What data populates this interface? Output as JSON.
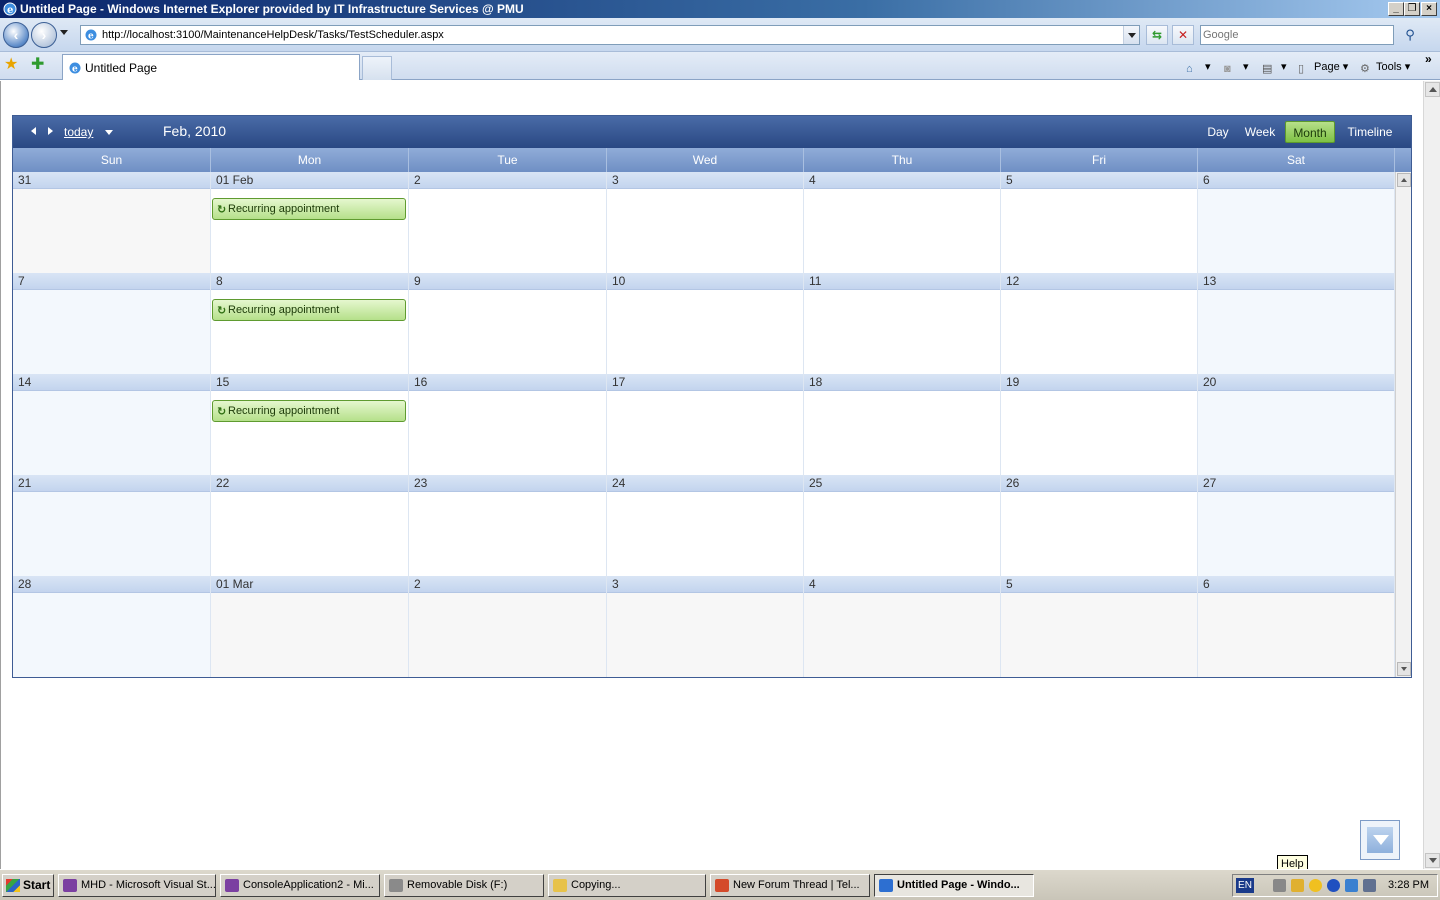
{
  "window": {
    "title": "Untitled Page - Windows Internet Explorer provided by IT Infrastructure Services @ PMU"
  },
  "browser": {
    "url": "http://localhost:3100/MaintenanceHelpDesk/Tasks/TestScheduler.aspx",
    "search_placeholder": "Google",
    "tab_label": "Untitled Page",
    "commands": {
      "page": "Page",
      "tools": "Tools"
    }
  },
  "scheduler": {
    "today_label": "today",
    "current_period": "Feb, 2010",
    "views": [
      "Day",
      "Week",
      "Month",
      "Timeline"
    ],
    "active_view": "Month",
    "day_names": [
      "Sun",
      "Mon",
      "Tue",
      "Wed",
      "Thu",
      "Fri",
      "Sat"
    ],
    "weeks": [
      {
        "days": [
          {
            "label": "31",
            "other": true
          },
          {
            "label": "01 Feb",
            "appt": "Recurring appointment"
          },
          {
            "label": "2"
          },
          {
            "label": "3"
          },
          {
            "label": "4"
          },
          {
            "label": "5"
          },
          {
            "label": "6"
          }
        ]
      },
      {
        "days": [
          {
            "label": "7"
          },
          {
            "label": "8",
            "appt": "Recurring appointment"
          },
          {
            "label": "9"
          },
          {
            "label": "10"
          },
          {
            "label": "11"
          },
          {
            "label": "12"
          },
          {
            "label": "13"
          }
        ]
      },
      {
        "days": [
          {
            "label": "14"
          },
          {
            "label": "15",
            "appt": "Recurring appointment"
          },
          {
            "label": "16"
          },
          {
            "label": "17"
          },
          {
            "label": "18"
          },
          {
            "label": "19"
          },
          {
            "label": "20"
          }
        ]
      },
      {
        "days": [
          {
            "label": "21"
          },
          {
            "label": "22"
          },
          {
            "label": "23"
          },
          {
            "label": "24"
          },
          {
            "label": "25"
          },
          {
            "label": "26"
          },
          {
            "label": "27"
          }
        ]
      },
      {
        "days": [
          {
            "label": "28"
          },
          {
            "label": "01 Mar",
            "other": true
          },
          {
            "label": "2",
            "other": true
          },
          {
            "label": "3",
            "other": true
          },
          {
            "label": "4",
            "other": true
          },
          {
            "label": "5",
            "other": true
          },
          {
            "label": "6",
            "other": true
          }
        ]
      }
    ]
  },
  "tooltip": "Help",
  "taskbar": {
    "start_label": "Start",
    "items": [
      {
        "label": "MHD - Microsoft Visual St...",
        "icon_color": "#7b3fa1"
      },
      {
        "label": "ConsoleApplication2 - Mi...",
        "icon_color": "#7b3fa1"
      },
      {
        "label": "Removable Disk (F:)",
        "icon_color": "#8a8a8a"
      },
      {
        "label": "Copying...",
        "icon_color": "#e7c24a"
      },
      {
        "label": "New Forum Thread | Tel...",
        "icon_color": "#d44a2a"
      },
      {
        "label": "Untitled Page - Windo...",
        "icon_color": "#2d6fd1",
        "active": true
      }
    ],
    "lang": "EN",
    "clock": "3:28 PM"
  },
  "colors": {
    "header": "#2a4883",
    "active_view": "#7ec144",
    "appointment": "#b5e08a"
  }
}
